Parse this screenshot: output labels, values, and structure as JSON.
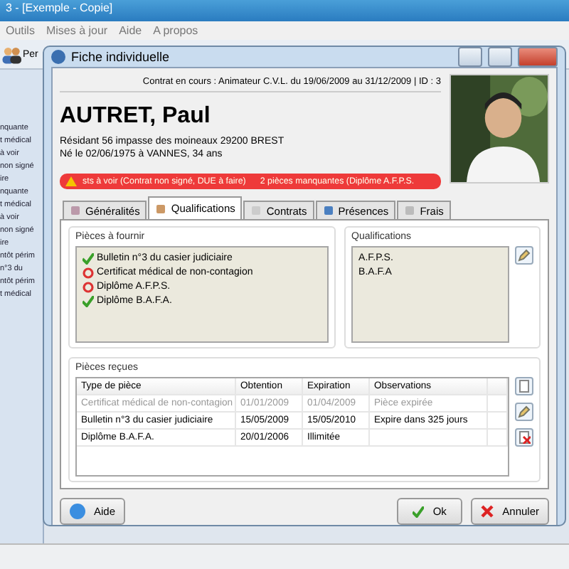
{
  "app": {
    "title": "3 - [Exemple - Copie]",
    "menu": [
      "Outils",
      "Mises à jour",
      "Aide",
      "A propos"
    ],
    "toolbar_label": "Per",
    "sidebar": [
      "nquante",
      "t médical",
      "à voir",
      "non signé",
      "ire",
      "nquante",
      "t médical",
      "à voir",
      "non signé",
      "ire",
      "ntôt périm",
      "n°3 du",
      "ntôt périm",
      "t médical"
    ]
  },
  "dialog": {
    "title": "Fiche individuelle",
    "contract": "Contrat en cours : Animateur C.V.L. du 19/06/2009 au 31/12/2009 | ID : 3",
    "name": "AUTRET, Paul",
    "address": "Résidant 56 impasse des moineaux 29200 BREST",
    "birth": "Né le 02/06/1975 à VANNES, 34 ans",
    "alerts": [
      "sts à voir (Contrat non signé, DUE à faire)",
      "2 pièces manquantes (Diplôme A.F.P.S."
    ],
    "tabs": [
      {
        "label": "Généralités",
        "selected": false
      },
      {
        "label": "Qualifications",
        "selected": true
      },
      {
        "label": "Contrats",
        "selected": false
      },
      {
        "label": "Présences",
        "selected": false
      },
      {
        "label": "Frais",
        "selected": false
      }
    ],
    "pieces_group": "Pièces à fournir",
    "pieces": [
      {
        "label": "Bulletin n°3 du casier judiciaire",
        "provided": true
      },
      {
        "label": "Certificat médical de non-contagion",
        "provided": false
      },
      {
        "label": "Diplôme A.F.P.S.",
        "provided": false
      },
      {
        "label": "Diplôme B.A.F.A.",
        "provided": true
      }
    ],
    "qualifications_group": "Qualifications",
    "qualifications": [
      "A.F.P.S.",
      "B.A.F.A"
    ],
    "received_group": "Pièces reçues",
    "table": {
      "columns": [
        "Type de pièce",
        "Obtention",
        "Expiration",
        "Observations"
      ],
      "rows": [
        {
          "cells": [
            "Certificat médical de non-contagion",
            "01/01/2009",
            "01/04/2009",
            "Pièce expirée"
          ],
          "expired": true
        },
        {
          "cells": [
            "Bulletin n°3 du casier judiciaire",
            "15/05/2009",
            "15/05/2010",
            "Expire dans 325 jours"
          ],
          "expired": false
        },
        {
          "cells": [
            "Diplôme B.A.F.A.",
            "20/01/2006",
            "Illimitée",
            ""
          ],
          "expired": false
        }
      ]
    },
    "buttons": {
      "help": "Aide",
      "ok": "Ok",
      "cancel": "Annuler"
    }
  }
}
